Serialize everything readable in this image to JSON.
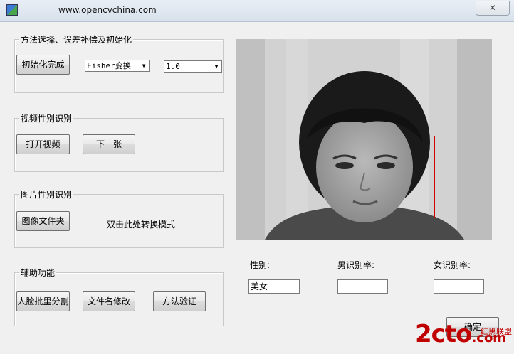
{
  "window": {
    "title": "www.opencvchina.com",
    "close_label": "✕"
  },
  "group_method": {
    "title": "方法选择、误差补偿及初始化",
    "init_button": "初始化完成",
    "method_select": "Fisher变换",
    "value_select": "1.0"
  },
  "group_video": {
    "title": "视频性别识别",
    "open_button": "打开视频",
    "next_button": "下一张"
  },
  "group_image": {
    "title": "图片性别识别",
    "folder_button": "图像文件夹",
    "hint": "双击此处转换模式"
  },
  "group_tools": {
    "title": "辅助功能",
    "batch_button": "人脸批里分割",
    "rename_button": "文件名修改",
    "verify_button": "方法验证"
  },
  "result": {
    "gender_label": "性别:",
    "gender_value": "美女",
    "male_label": "男识别率:",
    "male_value": "",
    "female_label": "女识别率:",
    "female_value": ""
  },
  "ok_button": "确定",
  "watermark": {
    "brand": "2cto",
    "suffix": ".com",
    "cn": "红黑联盟"
  },
  "colors": {
    "facebox": "#d00000",
    "watermark": "#c00000"
  }
}
